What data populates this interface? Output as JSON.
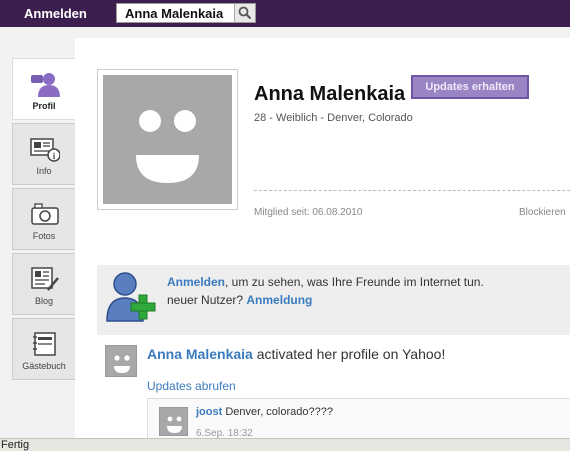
{
  "topbar": {
    "login_label": "Anmelden",
    "search_value": "Anna Malenkaia",
    "search_icon": "search-icon"
  },
  "tabs": [
    {
      "label": "Profil",
      "icon": "profile-icon",
      "active": true
    },
    {
      "label": "Info",
      "icon": "info-icon",
      "active": false
    },
    {
      "label": "Fotos",
      "icon": "camera-icon",
      "active": false
    },
    {
      "label": "Blog",
      "icon": "blog-icon",
      "active": false
    },
    {
      "label": "Gästebuch",
      "icon": "guestbook-icon",
      "active": false
    }
  ],
  "profile": {
    "name": "Anna Malenkaia",
    "details": "28 - Weiblich - Denver, Colorado",
    "follow_button": "Updates erhalten",
    "member_since": "Mitglied seit: 06.08.2010",
    "block_label": "Blockieren"
  },
  "notice": {
    "login_link": "Anmelden",
    "line1_rest": ", um zu sehen, was Ihre Freunde im Internet tun.",
    "line2_prefix": "neuer Nutzer? ",
    "signup_link": "Anmeldung"
  },
  "activity": {
    "user": "Anna Malenkaia",
    "text": " activated her profile on Yahoo!",
    "updates_link": "Updates abrufen",
    "comment": {
      "user": "joost",
      "text": " Denver, colorado????",
      "date": "6.Sep. 18:32"
    }
  },
  "statusbar": {
    "text": "Fertig"
  },
  "colors": {
    "topbar": "#3d1f4f",
    "accent_purple": "#9a84c4",
    "link_blue": "#3a7bbf"
  }
}
